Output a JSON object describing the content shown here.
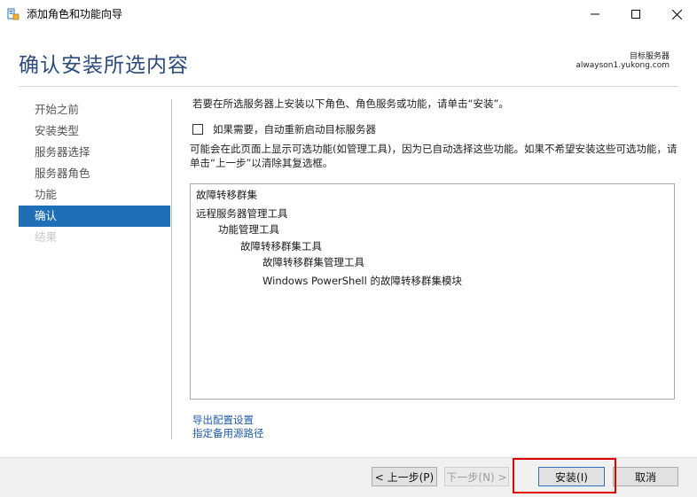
{
  "window": {
    "title": "添加角色和功能向导",
    "icons": {
      "app": "server-manager-icon",
      "minimize": "minimize-icon",
      "maximize": "maximize-icon",
      "close": "close-icon"
    }
  },
  "header": {
    "title": "确认安装所选内容",
    "target_label": "目标服务器",
    "target_value": "alwayson1.yukong.com"
  },
  "nav": {
    "items": [
      {
        "label": "开始之前",
        "state": "normal"
      },
      {
        "label": "安装类型",
        "state": "normal"
      },
      {
        "label": "服务器选择",
        "state": "normal"
      },
      {
        "label": "服务器角色",
        "state": "normal"
      },
      {
        "label": "功能",
        "state": "normal"
      },
      {
        "label": "确认",
        "state": "active"
      },
      {
        "label": "结果",
        "state": "disabled"
      }
    ]
  },
  "main": {
    "intro": "若要在所选服务器上安装以下角色、角色服务或功能，请单击“安装”。",
    "restart_label": "如果需要，自动重新启动目标服务器",
    "restart_checked": false,
    "note": "可能会在此页面上显示可选功能(如管理工具)，因为已自动选择这些功能。如果不希望安装这些可选功能，请单击“上一步”以清除其复选框。",
    "features": [
      {
        "label": "故障转移群集",
        "level": 0
      },
      {
        "label": "远程服务器管理工具",
        "level": 0
      },
      {
        "label": "功能管理工具",
        "level": 1
      },
      {
        "label": "故障转移群集工具",
        "level": 2
      },
      {
        "label": "故障转移群集管理工具",
        "level": 3
      },
      {
        "label": "Windows PowerShell 的故障转移群集模块",
        "level": 3
      }
    ],
    "links": {
      "export": "导出配置设置",
      "alt_source": "指定备用源路径"
    }
  },
  "footer": {
    "prev": "< 上一步(P)",
    "next": "下一步(N) >",
    "install": "安装(I)",
    "cancel": "取消"
  },
  "colors": {
    "accent": "#1f6fb6",
    "title": "#2a4b7c",
    "link": "#1f5aa6",
    "highlight": "#e00000"
  }
}
